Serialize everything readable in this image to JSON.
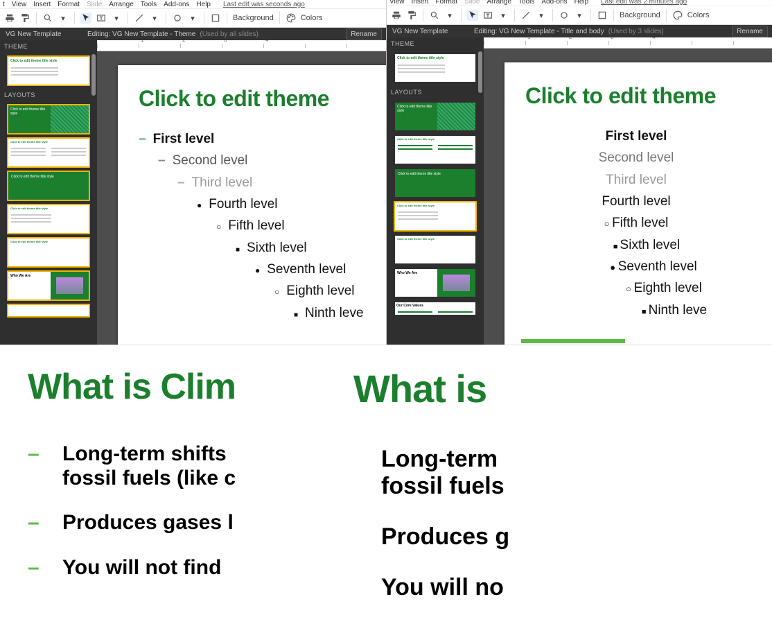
{
  "menu": {
    "view": "View",
    "insert": "Insert",
    "format": "Format",
    "slide": "Slide",
    "arrange": "Arrange",
    "tools": "Tools",
    "addons": "Add-ons",
    "help": "Help"
  },
  "editor_left": {
    "t_prefix": "t",
    "last_edit": "Last edit was seconds ago",
    "background": "Background",
    "colors_label": "Colors",
    "template_name": "VG New Template",
    "editing_label": "Editing: VG New Template - Theme",
    "used_by": "(Used by all slides)",
    "rename": "Rename",
    "theme_label": "THEME",
    "layouts_label": "LAYOUTS",
    "slide": {
      "title": "Click to edit theme",
      "levels": [
        "First level",
        "Second level",
        "Third level",
        "Fourth level",
        "Fifth level",
        "Sixth level",
        "Seventh level",
        "Eighth level",
        "Ninth leve"
      ]
    },
    "ruler": [
      "1",
      "2",
      "3",
      "4"
    ],
    "thumbs": {
      "t1": "Click to edit theme title style",
      "t2": "Click to edit theme title style",
      "t3": "Click to edit theme title style",
      "t4": "Click to edit theme title style",
      "t5": "Click to edit theme title style",
      "t6": "Click to edit theme title style",
      "t7": "Who We Are"
    }
  },
  "editor_right": {
    "last_edit": "Last edit was 2 minutes ago",
    "background": "Background",
    "colors_label": "Colors",
    "template_name": "VG New Template",
    "editing_label": "Editing: VG New Template - Title and body",
    "used_by": "(Used by 3 slides)",
    "rename": "Rename",
    "theme_label": "THEME",
    "layouts_label": "LAYOUTS",
    "slide": {
      "title": "Click to edit theme",
      "levels": [
        "First level",
        "Second level",
        "Third level",
        "Fourth level",
        "Fifth level",
        "Sixth level",
        "Seventh level",
        "Eighth level",
        "Ninth leve"
      ]
    },
    "ruler": [
      "1",
      "2",
      "3",
      "4"
    ],
    "thumbs": {
      "t1": "Click to edit theme title style",
      "t2": "Click to edit theme title style",
      "t3": "Click to edit theme title style",
      "t4": "Click to edit theme title style",
      "t5": "Click to edit theme title style",
      "t7": "Who We Are",
      "t8": "Our Core Values"
    }
  },
  "bottom_left": {
    "title": "What is Clim",
    "items": [
      "Long-term shifts\nfossil fuels (like c",
      "Produces gases l",
      "You will not find"
    ]
  },
  "bottom_right": {
    "title": "What is",
    "items": [
      "Long-term\nfossil fuels",
      "Produces g",
      "You will no"
    ]
  }
}
